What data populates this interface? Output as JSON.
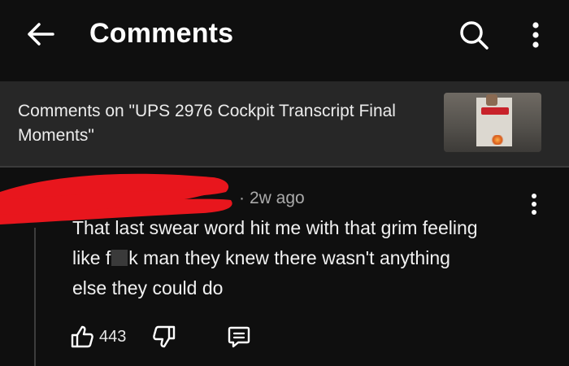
{
  "header": {
    "title": "Comments",
    "back_icon": "back-arrow-icon",
    "search_icon": "search-icon",
    "more_icon": "more-vertical-icon"
  },
  "video": {
    "title": "Comments on \"UPS 2976 Cockpit Transcript Final Moments\"",
    "thumbnail_icon": "video-thumbnail"
  },
  "comment": {
    "author": "",
    "time_prefix": "·",
    "time": "2w ago",
    "text_before_censor": "That last swear word hit me with that grim feeling\nlike f",
    "text_after_censor": "k man they knew there wasn't anything\nelse they could do",
    "likes": "443",
    "like_icon": "thumbs-up-icon",
    "dislike_icon": "thumbs-down-icon",
    "reply_icon": "reply-comment-icon",
    "more_icon": "more-vertical-icon"
  },
  "colors": {
    "background": "#0f0f0f",
    "video_bar": "#272727",
    "redaction": "#e8161d",
    "text": "#f1f1f1",
    "secondary_text": "#aaaaaa"
  }
}
